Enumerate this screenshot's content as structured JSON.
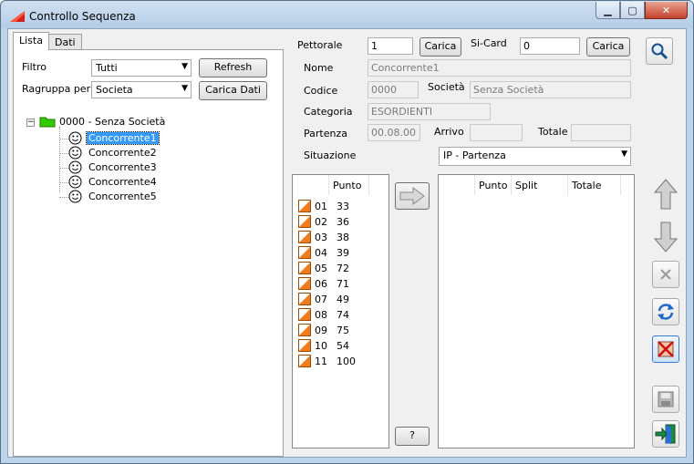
{
  "window": {
    "title": "Controllo Sequenza"
  },
  "tabs": [
    {
      "label": "Lista"
    },
    {
      "label": "Dati"
    }
  ],
  "left": {
    "filtro_label": "Filtro",
    "filtro_value": "Tutti",
    "refresh_label": "Refresh",
    "raggruppa_label": "Ragruppa per",
    "raggruppa_value": "Societa",
    "carica_dati_label": "Carica Dati",
    "tree": {
      "root": "0000 - Senza Società",
      "items": [
        {
          "label": "Concorrente1",
          "selected": true
        },
        {
          "label": "Concorrente2"
        },
        {
          "label": "Concorrente3"
        },
        {
          "label": "Concorrente4"
        },
        {
          "label": "Concorrente5"
        }
      ]
    }
  },
  "form": {
    "pettorale_label": "Pettorale",
    "pettorale_value": "1",
    "carica_label": "Carica",
    "sicard_label": "Si-Card",
    "sicard_value": "0",
    "carica2_label": "Carica",
    "nome_label": "Nome",
    "nome_value": "Concorrente1",
    "codice_label": "Codice",
    "codice_value": "0000",
    "societa_label": "Società",
    "societa_value": "Senza Società",
    "categoria_label": "Categoria",
    "categoria_value": "ESORDIENTI",
    "partenza_label": "Partenza",
    "partenza_value": "00.08.00",
    "arrivo_label": "Arrivo",
    "arrivo_value": "",
    "totale_label": "Totale",
    "totale_value": "",
    "situazione_label": "Situazione",
    "situazione_value": "IP - Partenza"
  },
  "punti": {
    "header": "Punto",
    "rows": [
      {
        "n": "01",
        "punto": "33"
      },
      {
        "n": "02",
        "punto": "36"
      },
      {
        "n": "03",
        "punto": "38"
      },
      {
        "n": "04",
        "punto": "39"
      },
      {
        "n": "05",
        "punto": "72"
      },
      {
        "n": "06",
        "punto": "71"
      },
      {
        "n": "07",
        "punto": "49"
      },
      {
        "n": "08",
        "punto": "74"
      },
      {
        "n": "09",
        "punto": "75"
      },
      {
        "n": "10",
        "punto": "54"
      },
      {
        "n": "11",
        "punto": "100"
      }
    ]
  },
  "result_grid": {
    "col_punto": "Punto",
    "col_split": "Split",
    "col_totale": "Totale"
  },
  "help_label": "?",
  "icons": {
    "search": "magnifier-icon",
    "up": "arrow-up-icon",
    "down": "arrow-down-icon",
    "delete": "x-delete-icon",
    "refresh": "refresh-icon",
    "clear": "clear-icon",
    "save": "floppy-icon",
    "exit": "exit-icon",
    "transfer": "arrow-right-icon"
  },
  "colors": {
    "selection": "#3399ff",
    "folder": "#33cc00",
    "punto_icon": "#f07c1e"
  }
}
